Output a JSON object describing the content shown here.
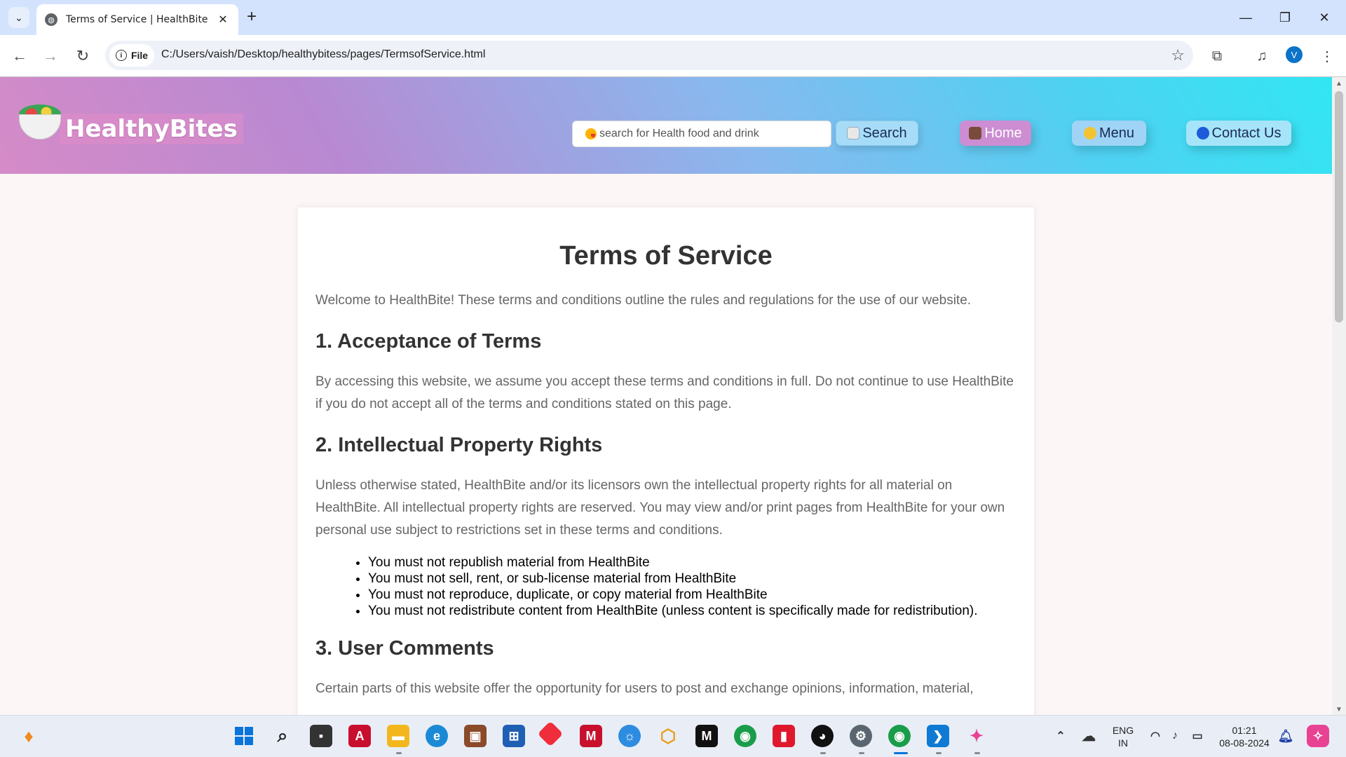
{
  "browser": {
    "tab_title": "Terms of Service | HealthBite",
    "new_tab_label": "+",
    "site_chip": "File",
    "url": "C:/Users/vaish/Desktop/healthybitess/pages/TermsofService.html",
    "profile_initial": "V",
    "icons": [
      "tab-search-icon",
      "globe-icon",
      "close-icon",
      "back-icon",
      "forward-icon",
      "reload-icon",
      "info-icon",
      "star-icon",
      "extensions-icon",
      "media-icon",
      "menu-dots-icon",
      "minimize-icon",
      "restore-icon"
    ]
  },
  "header": {
    "logo_text": "HealthyBites",
    "search_placeholder": "search for Health food and drink",
    "search_button": "Search",
    "nav": {
      "home": "Home",
      "menu": "Menu",
      "contact": "Contact Us"
    },
    "gradient_colors": [
      "#d58bc7",
      "#89b8ee",
      "#32e6f2"
    ]
  },
  "content": {
    "title": "Terms of Service",
    "intro": "Welcome to HealthBite! These terms and conditions outline the rules and regulations for the use of our website.",
    "sections": [
      {
        "heading": "1. Acceptance of Terms",
        "body": "By accessing this website, we assume you accept these terms and conditions in full. Do not continue to use HealthBite if you do not accept all of the terms and conditions stated on this page."
      },
      {
        "heading": "2. Intellectual Property Rights",
        "body": "Unless otherwise stated, HealthBite and/or its licensors own the intellectual property rights for all material on HealthBite. All intellectual property rights are reserved. You may view and/or print pages from HealthBite for your own personal use subject to restrictions set in these terms and conditions.",
        "bullets": [
          "You must not republish material from HealthBite",
          "You must not sell, rent, or sub-license material from HealthBite",
          "You must not reproduce, duplicate, or copy material from HealthBite",
          "You must not redistribute content from HealthBite (unless content is specifically made for redistribution)."
        ]
      },
      {
        "heading": "3. User Comments",
        "body": "Certain parts of this website offer the opportunity for users to post and exchange opinions, information, material,"
      }
    ]
  },
  "taskbar": {
    "language_line1": "ENG",
    "language_line2": "IN",
    "time": "01:21",
    "date": "08-08-2024"
  }
}
